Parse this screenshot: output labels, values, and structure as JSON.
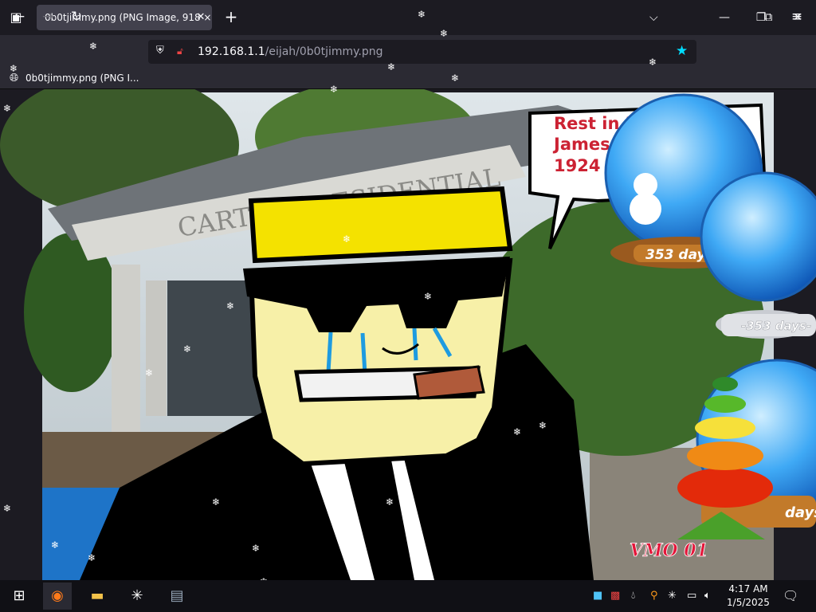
{
  "browser": {
    "tab_title": "0b0tjimmy.png (PNG Image, 918 ×",
    "url_host": "192.168.1.1",
    "url_path": "/eijah/0b0tjimmy.png",
    "bookmark_label": "0b0tjimmy.png (PNG I..."
  },
  "image": {
    "building_sign": "CARTER PRESIDENTIAL",
    "speech_line1": "Rest in Peace",
    "speech_line2": "James Earl",
    "speech_line3": "1924",
    "globe1_days": "353 days",
    "globe2_days": "-353 days-",
    "globe3_days": "days",
    "watermark": "VMO 01"
  },
  "taskbar": {
    "time": "4:17 AM",
    "date": "1/5/2025"
  },
  "icons": {
    "tab_list": "tab-list-icon",
    "close": "close-icon",
    "new_tab": "plus-icon",
    "back": "back-arrow-icon",
    "forward": "forward-arrow-icon",
    "reload": "reload-icon",
    "shield": "shield-icon",
    "lock": "lock-icon",
    "star": "star-icon",
    "extensions": "puzzle-icon",
    "menu": "hamburger-menu-icon",
    "globe": "globe-icon"
  },
  "colors": {
    "speech_text": "#cc2233",
    "hair": "#f4e200",
    "skin": "#f7f0a8",
    "accent": "#00ddff"
  }
}
